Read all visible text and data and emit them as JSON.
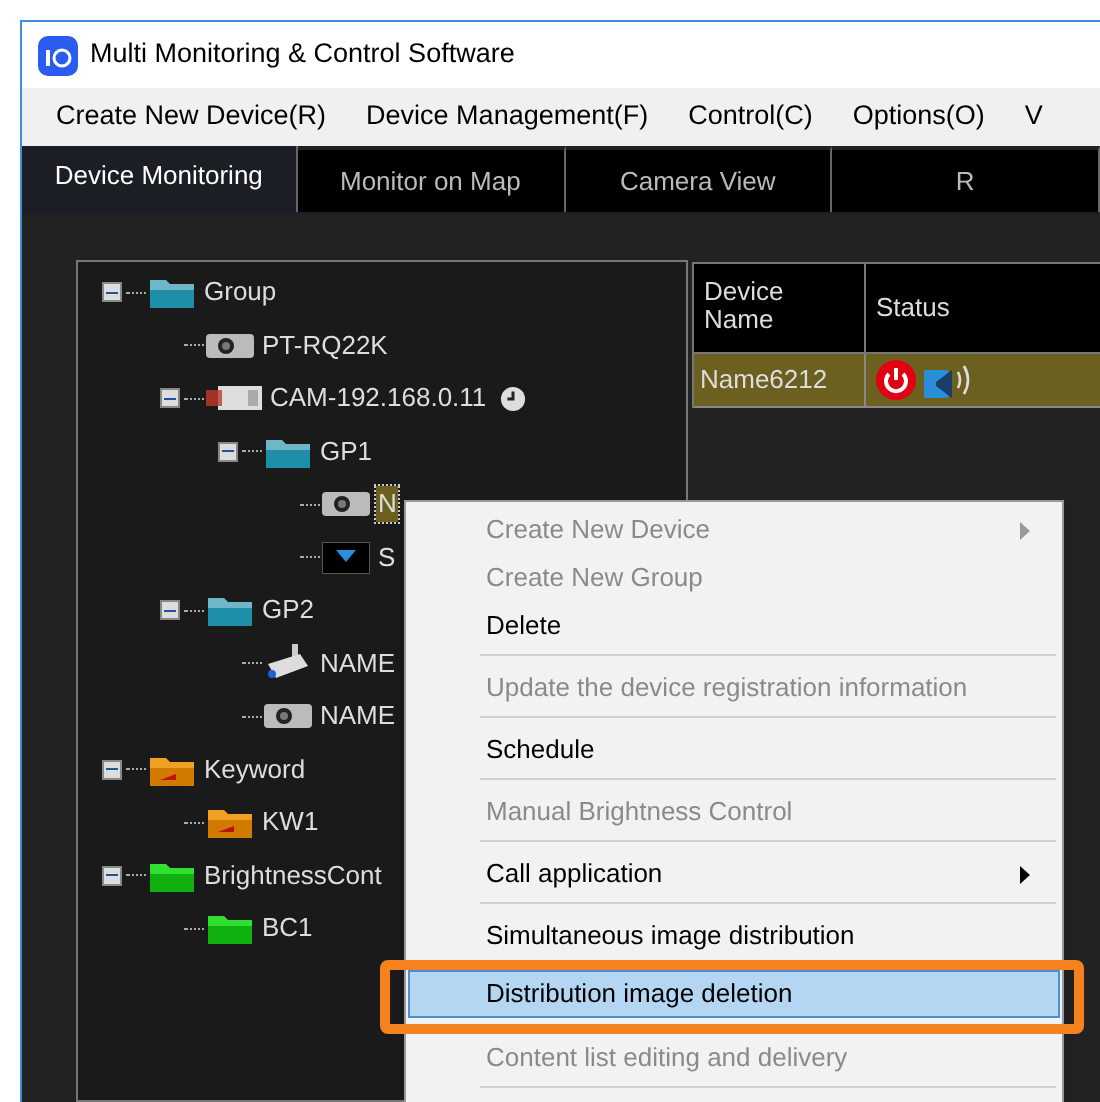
{
  "window": {
    "title": "Multi Monitoring & Control Software"
  },
  "menu_bar": [
    "Create New Device(R)",
    "Device Management(F)",
    "Control(C)",
    "Options(O)",
    "V"
  ],
  "tabs": [
    {
      "label": "Device Monitoring",
      "selected": true
    },
    {
      "label": "Monitor on Map",
      "selected": false
    },
    {
      "label": "Camera View",
      "selected": false
    },
    {
      "label": "R",
      "selected": false
    }
  ],
  "tree": [
    {
      "label": "Group",
      "kind": "folder-teal",
      "selected": false,
      "expanded": true,
      "children": [
        {
          "label": "PT-RQ22K",
          "kind": "projector",
          "selected": false
        },
        {
          "label": "CAM-192.168.0.11",
          "kind": "camera",
          "selected": false,
          "scheduled": true,
          "expanded": true,
          "children": [
            {
              "label": "GP1",
              "kind": "folder-teal",
              "selected": false,
              "expanded": true,
              "children": [
                {
                  "label": "N",
                  "kind": "projector",
                  "selected": true
                },
                {
                  "label": "S",
                  "kind": "display",
                  "selected": false
                }
              ]
            }
          ]
        },
        {
          "label": "GP2",
          "kind": "folder-teal",
          "selected": false,
          "expanded": true,
          "children": [
            {
              "label": "NAME",
              "kind": "cctv",
              "selected": false
            },
            {
              "label": "NAME",
              "kind": "projector",
              "selected": false
            }
          ]
        }
      ]
    },
    {
      "label": "Keyword",
      "kind": "folder-orange",
      "selected": false,
      "expanded": true,
      "children": [
        {
          "label": "KW1",
          "kind": "folder-orange",
          "selected": false
        }
      ]
    },
    {
      "label": "BrightnessCont",
      "kind": "folder-green",
      "selected": false,
      "expanded": true,
      "children": [
        {
          "label": "BC1",
          "kind": "folder-green",
          "selected": false
        }
      ]
    }
  ],
  "table": {
    "columns": [
      "Device\nName",
      "Status"
    ],
    "rows": [
      {
        "name": "Name6212",
        "power_on": false,
        "selected": true
      }
    ]
  },
  "context_menu": [
    {
      "label": "Create New Device",
      "disabled": true,
      "submenu": true,
      "separator_after": false,
      "selected": false
    },
    {
      "label": "Create New Group",
      "disabled": true,
      "submenu": false,
      "separator_after": false,
      "selected": false
    },
    {
      "label": "Delete",
      "disabled": false,
      "submenu": false,
      "separator_after": true,
      "selected": false
    },
    {
      "label": "Update the device registration information",
      "disabled": true,
      "submenu": false,
      "separator_after": true,
      "selected": false
    },
    {
      "label": "Schedule",
      "disabled": false,
      "submenu": false,
      "separator_after": true,
      "selected": false
    },
    {
      "label": "Manual Brightness Control",
      "disabled": true,
      "submenu": false,
      "separator_after": true,
      "selected": false
    },
    {
      "label": "Call application",
      "disabled": false,
      "submenu": true,
      "separator_after": true,
      "selected": false
    },
    {
      "label": "Simultaneous image distribution",
      "disabled": false,
      "submenu": false,
      "separator_after": false,
      "selected": false
    },
    {
      "label": "Distribution image deletion",
      "disabled": false,
      "submenu": false,
      "separator_after": false,
      "selected": true
    },
    {
      "label": "Content list editing and delivery",
      "disabled": true,
      "submenu": false,
      "separator_after": true,
      "selected": false
    }
  ]
}
